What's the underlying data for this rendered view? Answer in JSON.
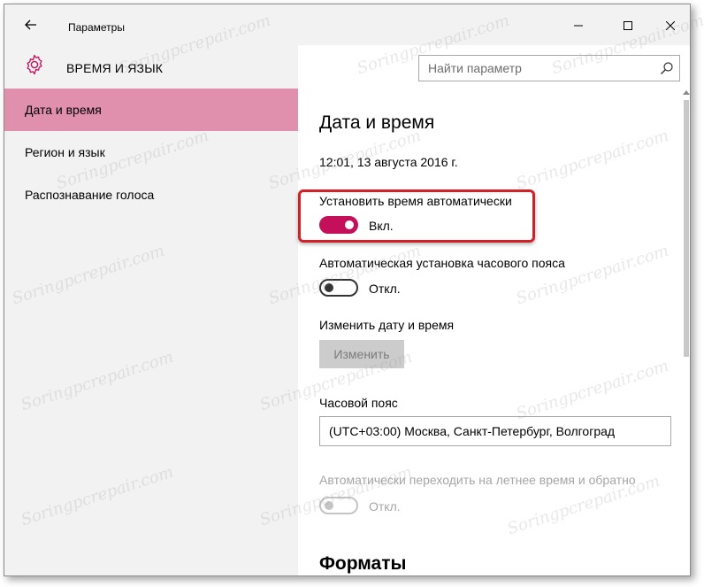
{
  "window": {
    "title": "Параметры"
  },
  "header": {
    "section_title": "ВРЕМЯ И ЯЗЫК",
    "search_placeholder": "Найти параметр"
  },
  "sidebar": {
    "items": [
      {
        "label": "Дата и время",
        "active": true
      },
      {
        "label": "Регион и язык",
        "active": false
      },
      {
        "label": "Распознавание голоса",
        "active": false
      }
    ]
  },
  "main": {
    "page_title": "Дата и время",
    "current_datetime": "12:01, 13 августа 2016 г.",
    "auto_time": {
      "label": "Установить время автоматически",
      "state_label": "Вкл.",
      "on": true
    },
    "auto_timezone": {
      "label": "Автоматическая установка часового пояса",
      "state_label": "Откл.",
      "on": false
    },
    "change_datetime": {
      "label": "Изменить дату и время",
      "button_label": "Изменить"
    },
    "timezone": {
      "label": "Часовой пояс",
      "selected": "(UTC+03:00) Москва, Санкт-Петербург, Волгоград"
    },
    "dst": {
      "label": "Автоматически переходить на летнее время и обратно",
      "state_label": "Откл.",
      "on": false,
      "disabled": true
    },
    "formats_title": "Форматы"
  },
  "watermark_text": "Soringpcrepair.com",
  "colors": {
    "accent": "#c4105a",
    "nav_active": "#e08fad",
    "highlight": "#d32027"
  }
}
